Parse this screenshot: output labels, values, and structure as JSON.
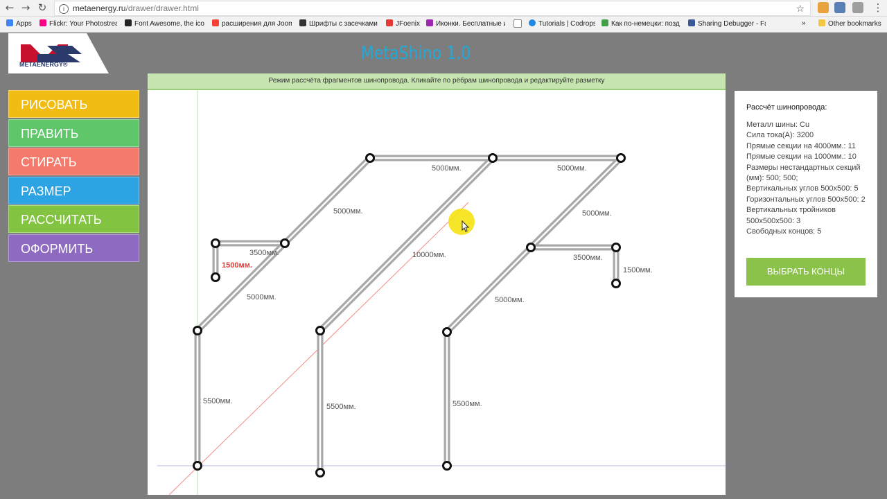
{
  "browser": {
    "url_host": "metaenergy.ru",
    "url_path": "/drawer/drawer.html",
    "bookmarks": [
      {
        "label": "Apps",
        "color": "#4285f4"
      },
      {
        "label": "Flickr: Your Photostrea",
        "color": "#ff0084"
      },
      {
        "label": "Font Awesome, the icon",
        "color": "#222222"
      },
      {
        "label": "расширения для Joomi",
        "color": "#f44336"
      },
      {
        "label": "Шрифты с засечками |",
        "color": "#333333"
      },
      {
        "label": "JFoenix",
        "color": "#e53935"
      },
      {
        "label": "Иконки. Бесплатные и",
        "color": "#9c27b0"
      },
      {
        "label": "",
        "color": "#bbbbbb"
      },
      {
        "label": "Tutorials | Codrops",
        "color": "#1e88e5"
      },
      {
        "label": "Как по-немецки: позд",
        "color": "#43a047"
      },
      {
        "label": "Sharing Debugger - Fac",
        "color": "#3b5998"
      }
    ],
    "overflow": "»",
    "other_bookmarks": "Other bookmarks"
  },
  "logo": {
    "text": "METAENERGY®"
  },
  "app_title": "MetaShino 1.0",
  "menu": [
    {
      "label": "РИСОВАТЬ",
      "color": "#f2bd13"
    },
    {
      "label": "ПРАВИТЬ",
      "color": "#5fc76a"
    },
    {
      "label": "СТИРАТЬ",
      "color": "#f47a6b"
    },
    {
      "label": "РАЗМЕР",
      "color": "#2ea3e3"
    },
    {
      "label": "РАССЧИТАТЬ",
      "color": "#82c341"
    },
    {
      "label": "ОФОРМИТЬ",
      "color": "#8e6bc1"
    }
  ],
  "mode_text": "Режим рассчёта фрагментов шинопровода. Кликайте по рёбрам шинопровода и редактируйте разметку",
  "drawing_labels": [
    {
      "text": "5000мм.",
      "highlight": false
    },
    {
      "text": "5000мм.",
      "highlight": false
    },
    {
      "text": "5000мм.",
      "highlight": false
    },
    {
      "text": "5000мм.",
      "highlight": false
    },
    {
      "text": "3500мм.",
      "highlight": false
    },
    {
      "text": "1500мм.",
      "highlight": true
    },
    {
      "text": "10000мм.",
      "highlight": false
    },
    {
      "text": "3500мм.",
      "highlight": false
    },
    {
      "text": "1500мм.",
      "highlight": false
    },
    {
      "text": "5000мм.",
      "highlight": false
    },
    {
      "text": "5000мм.",
      "highlight": false
    },
    {
      "text": "5500мм.",
      "highlight": false
    },
    {
      "text": "5500мм.",
      "highlight": false
    },
    {
      "text": "5500мм.",
      "highlight": false
    }
  ],
  "panel": {
    "title": "Рассчёт шинопровода:",
    "lines": [
      "Металл шины: Cu",
      "Сила тока(А): 3200",
      "Прямые секции на 4000мм.: 11",
      "Прямые секции на 1000мм.: 10",
      "Размеры нестандартных секций (мм): 500; 500;",
      "Вертикальных углов 500x500: 5",
      "Горизонтальных углов 500x500: 2",
      "Вертикальных тройников 500x500x500: 3",
      "Свободных концов: 5"
    ],
    "button": "ВЫБРАТЬ КОНЦЫ"
  },
  "colors": {
    "accent_title": "#23a8d8",
    "highlight_label": "#e53935",
    "cursor_halo": "#f5e211"
  }
}
